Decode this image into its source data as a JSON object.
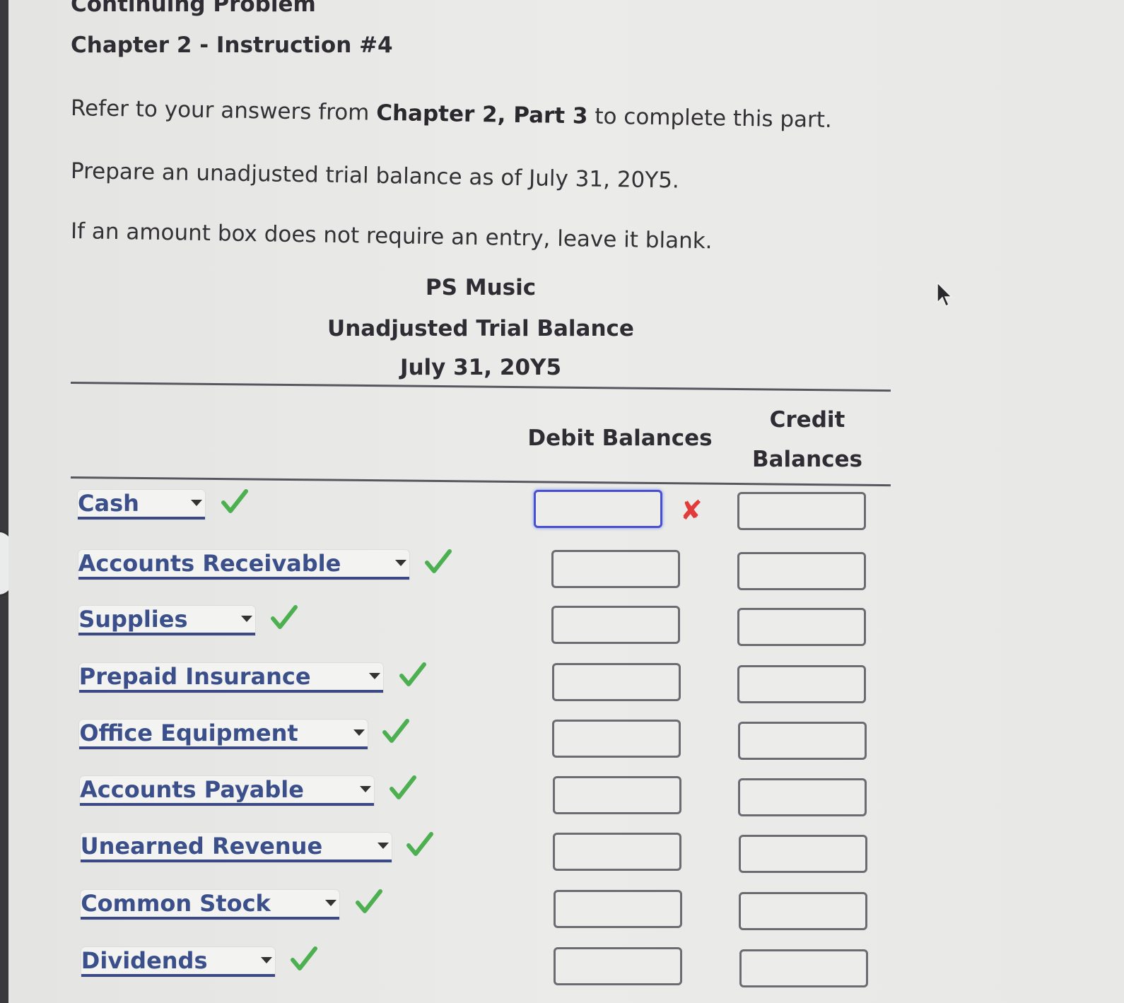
{
  "page": {
    "heading_top": "Continuing Problem",
    "heading": "Chapter 2 - Instruction #4",
    "instructions": [
      {
        "pre": "Refer to your answers from ",
        "bold": "Chapter 2, Part 3",
        "post": " to complete this part."
      },
      {
        "pre": "Prepare an unadjusted trial balance as of July 31, 20Y5.",
        "bold": "",
        "post": ""
      },
      {
        "pre": "If an amount box does not require an entry, leave it blank.",
        "bold": "",
        "post": ""
      }
    ]
  },
  "report": {
    "company": "PS Music",
    "title": "Unadjusted Trial Balance",
    "date": "July 31, 20Y5",
    "columns": {
      "debit": "Debit Balances",
      "credit_line1": "Credit",
      "credit_line2": "Balances"
    },
    "rows": [
      {
        "account": "Cash",
        "account_status": "correct",
        "debit": "",
        "credit": "",
        "debit_status": "incorrect"
      },
      {
        "account": "Accounts Receivable",
        "account_status": "correct",
        "debit": "",
        "credit": ""
      },
      {
        "account": "Supplies",
        "account_status": "correct",
        "debit": "",
        "credit": ""
      },
      {
        "account": "Prepaid Insurance",
        "account_status": "correct",
        "debit": "",
        "credit": ""
      },
      {
        "account": "Office Equipment",
        "account_status": "correct",
        "debit": "",
        "credit": ""
      },
      {
        "account": "Accounts Payable",
        "account_status": "correct",
        "debit": "",
        "credit": ""
      },
      {
        "account": "Unearned Revenue",
        "account_status": "correct",
        "debit": "",
        "credit": ""
      },
      {
        "account": "Common Stock",
        "account_status": "correct",
        "debit": "",
        "credit": ""
      },
      {
        "account": "Dividends",
        "account_status": "correct",
        "debit": "",
        "credit": ""
      }
    ]
  },
  "icons": {
    "correct": "check-icon",
    "incorrect": "x-icon",
    "dropdown": "caret-down-icon",
    "pointer": "mouse-pointer-icon"
  },
  "marks": {
    "incorrect_symbol": "✘"
  },
  "colors": {
    "correct": "#4caf50",
    "incorrect": "#e23b3b",
    "select_text": "#3b4f8a",
    "focus_border": "#4a4ed0"
  }
}
